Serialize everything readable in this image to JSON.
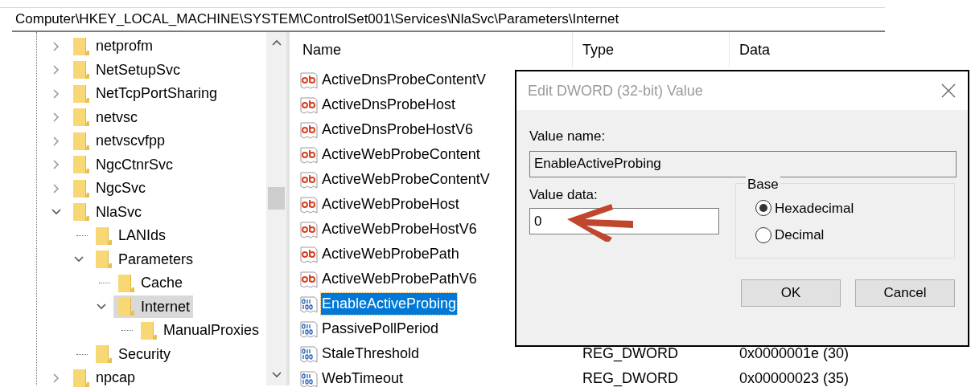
{
  "address_bar": "Computer\\HKEY_LOCAL_MACHINE\\SYSTEM\\ControlSet001\\Services\\NlaSvc\\Parameters\\Internet",
  "tree": [
    {
      "label": "netprofm",
      "expandable": true,
      "expanded": false,
      "selected": false
    },
    {
      "label": "NetSetupSvc",
      "expandable": true,
      "expanded": false,
      "selected": false
    },
    {
      "label": "NetTcpPortSharing",
      "expandable": true,
      "expanded": false,
      "selected": false
    },
    {
      "label": "netvsc",
      "expandable": true,
      "expanded": false,
      "selected": false
    },
    {
      "label": "netvscvfpp",
      "expandable": true,
      "expanded": false,
      "selected": false
    },
    {
      "label": "NgcCtnrSvc",
      "expandable": true,
      "expanded": false,
      "selected": false
    },
    {
      "label": "NgcSvc",
      "expandable": true,
      "expanded": false,
      "selected": false
    },
    {
      "label": "NlaSvc",
      "expandable": true,
      "expanded": true,
      "selected": false,
      "children": [
        {
          "label": "LANIds",
          "expandable": false,
          "expanded": false,
          "selected": false
        },
        {
          "label": "Parameters",
          "expandable": true,
          "expanded": true,
          "selected": false,
          "children": [
            {
              "label": "Cache",
              "expandable": false,
              "expanded": false,
              "selected": false
            },
            {
              "label": "Internet",
              "expandable": true,
              "expanded": true,
              "selected": true,
              "children": [
                {
                  "label": "ManualProxies",
                  "expandable": false,
                  "expanded": false,
                  "selected": false
                }
              ]
            }
          ]
        },
        {
          "label": "Security",
          "expandable": false,
          "expanded": false,
          "selected": false
        }
      ]
    },
    {
      "label": "npcap",
      "expandable": true,
      "expanded": false,
      "selected": false
    }
  ],
  "list": {
    "columns": [
      "Name",
      "Type",
      "Data"
    ],
    "rows": [
      {
        "kind": "string",
        "name": "ActiveDnsProbeContentV",
        "selected": false
      },
      {
        "kind": "string",
        "name": "ActiveDnsProbeHost",
        "selected": false
      },
      {
        "kind": "string",
        "name": "ActiveDnsProbeHostV6",
        "selected": false
      },
      {
        "kind": "string",
        "name": "ActiveWebProbeContent",
        "selected": false
      },
      {
        "kind": "string",
        "name": "ActiveWebProbeContentV",
        "selected": false
      },
      {
        "kind": "string",
        "name": "ActiveWebProbeHost",
        "selected": false
      },
      {
        "kind": "string",
        "name": "ActiveWebProbeHostV6",
        "selected": false
      },
      {
        "kind": "string",
        "name": "ActiveWebProbePath",
        "selected": false
      },
      {
        "kind": "string",
        "name": "ActiveWebProbePathV6",
        "selected": false
      },
      {
        "kind": "dword",
        "name": "EnableActiveProbing",
        "selected": true
      },
      {
        "kind": "dword",
        "name": "PassivePollPeriod",
        "selected": false
      },
      {
        "kind": "dword",
        "name": "StaleThreshold",
        "type": "REG_DWORD",
        "data": "0x0000001e (30)",
        "selected": false
      },
      {
        "kind": "dword",
        "name": "WebTimeout",
        "type": "REG_DWORD",
        "data": "0x00000023 (35)",
        "selected": false
      }
    ]
  },
  "dialog": {
    "title": "Edit DWORD (32-bit) Value",
    "value_name_label": "Value name:",
    "value_name": "EnableActiveProbing",
    "value_data_label": "Value data:",
    "value_data": "0",
    "base_label": "Base",
    "base_options": [
      {
        "label": "Hexadecimal",
        "selected": true
      },
      {
        "label": "Decimal",
        "selected": false
      }
    ],
    "buttons": [
      "OK",
      "Cancel"
    ]
  }
}
